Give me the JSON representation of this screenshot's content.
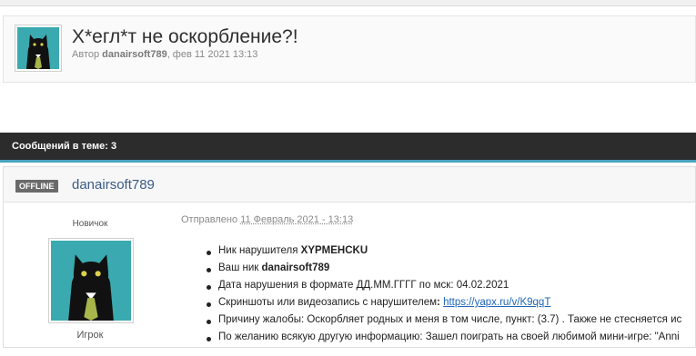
{
  "topic": {
    "title": "Х*егл*т не оскорбление?!",
    "meta_prefix": "Автор ",
    "author": "danairsoft789",
    "meta_suffix": ", фев 11 2021 13:13"
  },
  "thread": {
    "replies_count_label": "Сообщений в теме: 3"
  },
  "post": {
    "status_badge": "OFFLINE",
    "author": "danairsoft789",
    "rank": "Новичок",
    "group": "Игрок",
    "posted_label": "Отправлено ",
    "posted_date": "11 Февраль 2021 - 13:13",
    "items": [
      {
        "label": "Ник нарушителя ",
        "value": "XYPMEHCKU"
      },
      {
        "label": "Ваш ник ",
        "value": "danairsoft789"
      },
      {
        "label": "Дата нарушения в формате ДД.ММ.ГГГГ по мск: 04.02.2021",
        "value": ""
      },
      {
        "label": "Скриншоты или видеозапись с нарушителем",
        "value": ":",
        "link": "https://yapx.ru/v/K9qqT"
      },
      {
        "label": "Причину жалобы: Оскорбляет родных и меня в том числе, пункт: (3.7) . Также не стесняется ис",
        "value": ""
      },
      {
        "label": "По желанию всякую другую информацию: Зашел поиграть на своей любимой мини-игре: \"Anni",
        "value": ""
      }
    ]
  },
  "colors": {
    "header_bar": "#2c2c2c",
    "accent_stripe": "#4aa3bf",
    "link": "#1e66b8",
    "author_link": "#3c5b84",
    "badge": "#6a6a6a"
  },
  "icons": {
    "avatar": "black-cat-with-tie-avatar"
  }
}
